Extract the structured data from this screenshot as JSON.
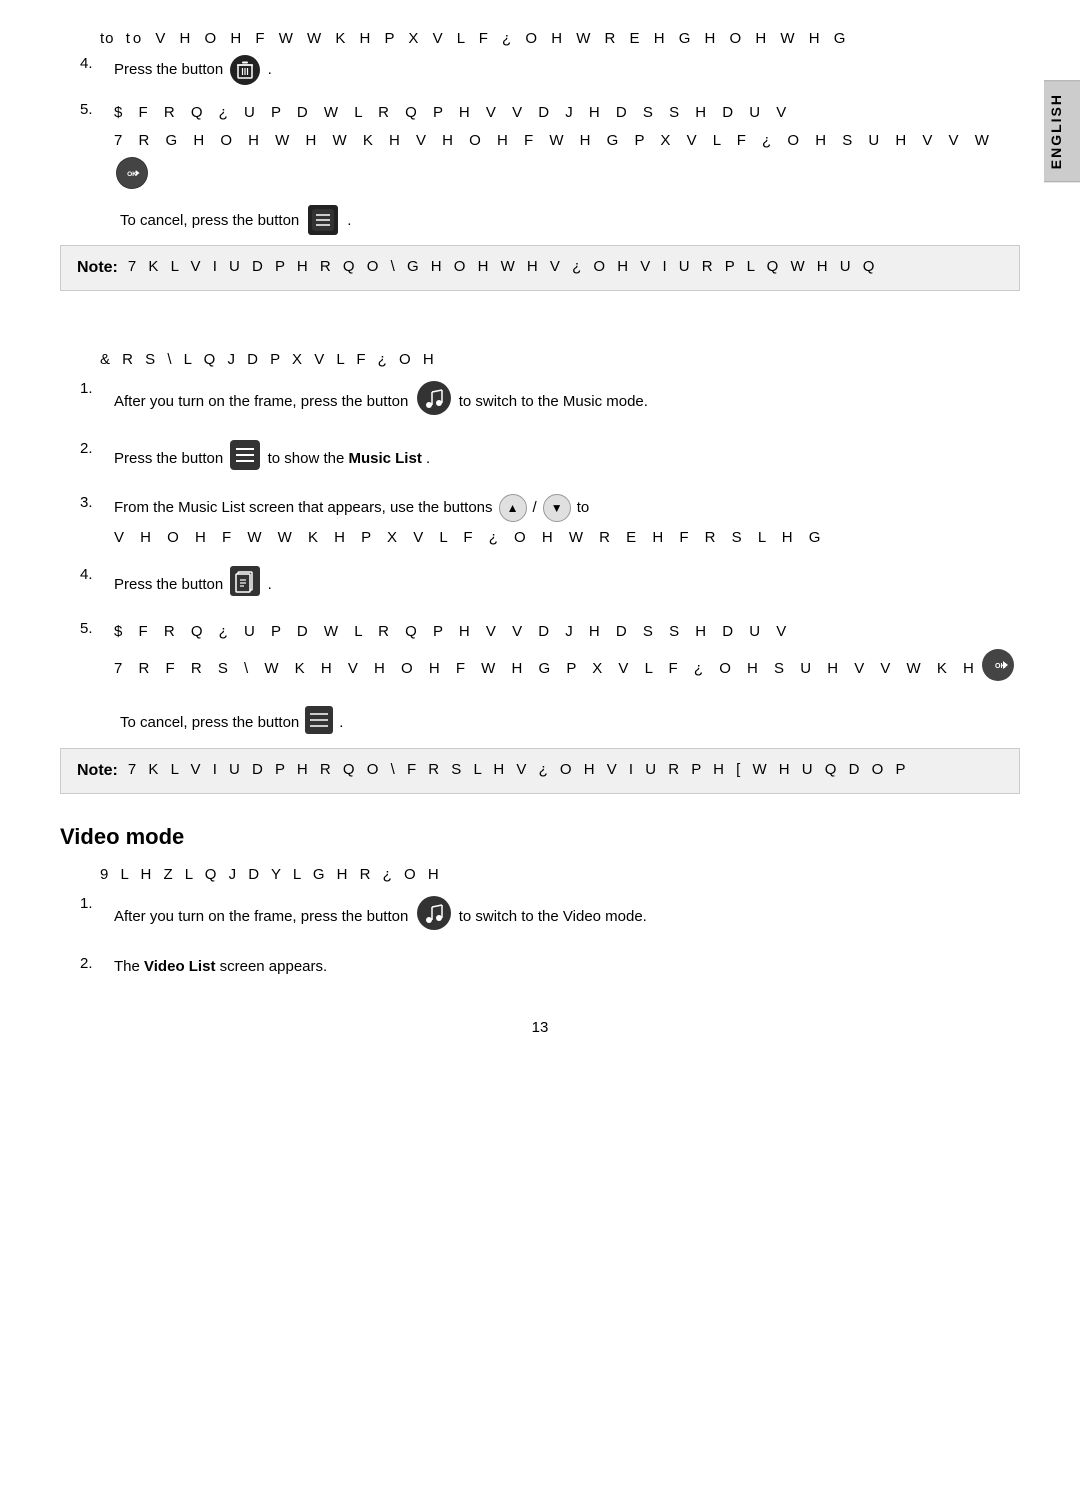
{
  "page": {
    "number": "13",
    "language_tab": "ENGLISH"
  },
  "delete_section": {
    "intro_line": "to V H O H F W   W K H   P X V L F   ¿ O H   W R   E H   G H O H W H G",
    "step4": {
      "number": "4.",
      "text_before": "Press the button",
      "text_after": "."
    },
    "step5": {
      "number": "5.",
      "line1": "$ F R Q ¿ U P D W L R Q   P H V V D J H   D S S H D U V",
      "line2": "7 R   G H O H W H   W K H   V H O H F W H G   P X V L F   ¿ O H   S U H V V  W"
    },
    "cancel_line": "To cancel, press the button",
    "note": {
      "label": "Note:",
      "text": "7 K L V   I U D P H   R Q O \\ G H O H W H V   ¿ O H V   I U R P  L Q W H U Q"
    }
  },
  "copy_section": {
    "title": "& R S \\ L Q J   D   P X V L F   ¿ O H",
    "step1": {
      "number": "1.",
      "text_before": "After you turn on the frame, press the button",
      "text_after": "to switch to the Music mode."
    },
    "step2": {
      "number": "2.",
      "text_before": "Press the button",
      "text_middle": "to show the",
      "text_bold": "Music List",
      "text_after": "."
    },
    "step3": {
      "number": "3.",
      "text_before": "From the Music List screen that appears, use the buttons",
      "text_after": "to",
      "line2": "V H O H F W   W K H   P X V L F   ¿ O H   W R   E H   F R S L H G"
    },
    "step4": {
      "number": "4.",
      "text_before": "Press the button",
      "text_after": "."
    },
    "step5": {
      "number": "5.",
      "line1": "$ F R Q ¿ U P D W L R Q   P H V V D J H   D S S H D U V",
      "line2": "7 R   F R S \\   W K H   V H O H F W H G   P X V L F   ¿ O H   S U H V V   W K H"
    },
    "cancel_line": "To cancel, press the button",
    "note": {
      "label": "Note:",
      "text": "7 K L V   I U D P H   R Q O \\   F R S L H V   ¿ O H V   I U R P   H [ W H U Q D O   P"
    }
  },
  "video_section": {
    "title": "Video mode",
    "sub_title": "9 L H Z L Q J   D   Y L G H R   ¿ O H",
    "step1": {
      "number": "1.",
      "text_before": "After you turn on the frame, press the button",
      "text_after": "to switch to the Video mode."
    },
    "step2": {
      "number": "2.",
      "text_before": "The",
      "text_bold": "Video List",
      "text_after": "screen appears."
    }
  },
  "buttons": {
    "trash_icon": "🗑",
    "menu_icon": "≡",
    "ok_icon": "OK▶",
    "arrow_up": "▲",
    "arrow_down": "▼",
    "music_mode": "♪",
    "copy_icon": "⊞"
  }
}
